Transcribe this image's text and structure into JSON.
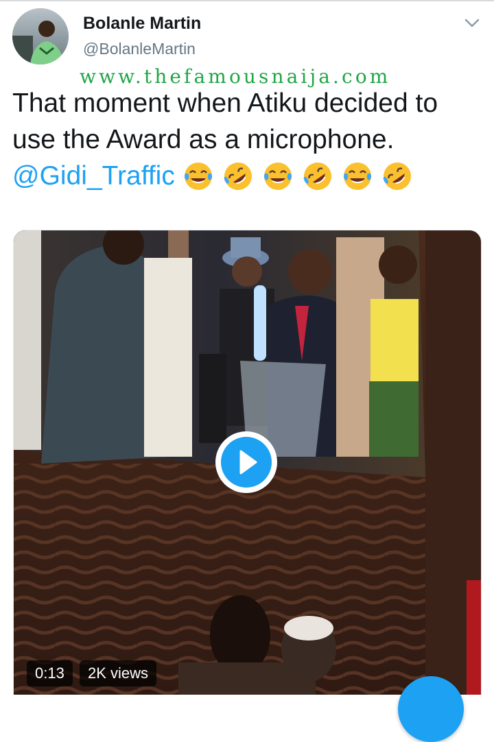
{
  "user": {
    "display_name": "Bolanle Martin",
    "handle": "@BolanleMartin",
    "avatar_icon": "avatar-photo"
  },
  "watermark": "www.thefamousnaija.com",
  "tweet": {
    "text_line_1": "That moment when Atiku decided to",
    "text_line_2": "use the Award as a microphone.",
    "mention": "@Gidi_Traffic",
    "emojis": [
      "face-with-tears-of-joy",
      "rolling-on-the-floor-laughing",
      "face-with-tears-of-joy",
      "rolling-on-the-floor-laughing",
      "face-with-tears-of-joy",
      "rolling-on-the-floor-laughing"
    ]
  },
  "video": {
    "duration": "0:13",
    "views": "2K views"
  },
  "colors": {
    "link": "#1da1f2",
    "watermark": "#21a546",
    "secondary_text": "#657786",
    "emoji_yellow": "#fbc02d",
    "emoji_tear": "#42a5f5"
  },
  "icons": {
    "menu_caret": "chevron-down-icon",
    "play": "play-icon",
    "compose": "compose-fab"
  }
}
